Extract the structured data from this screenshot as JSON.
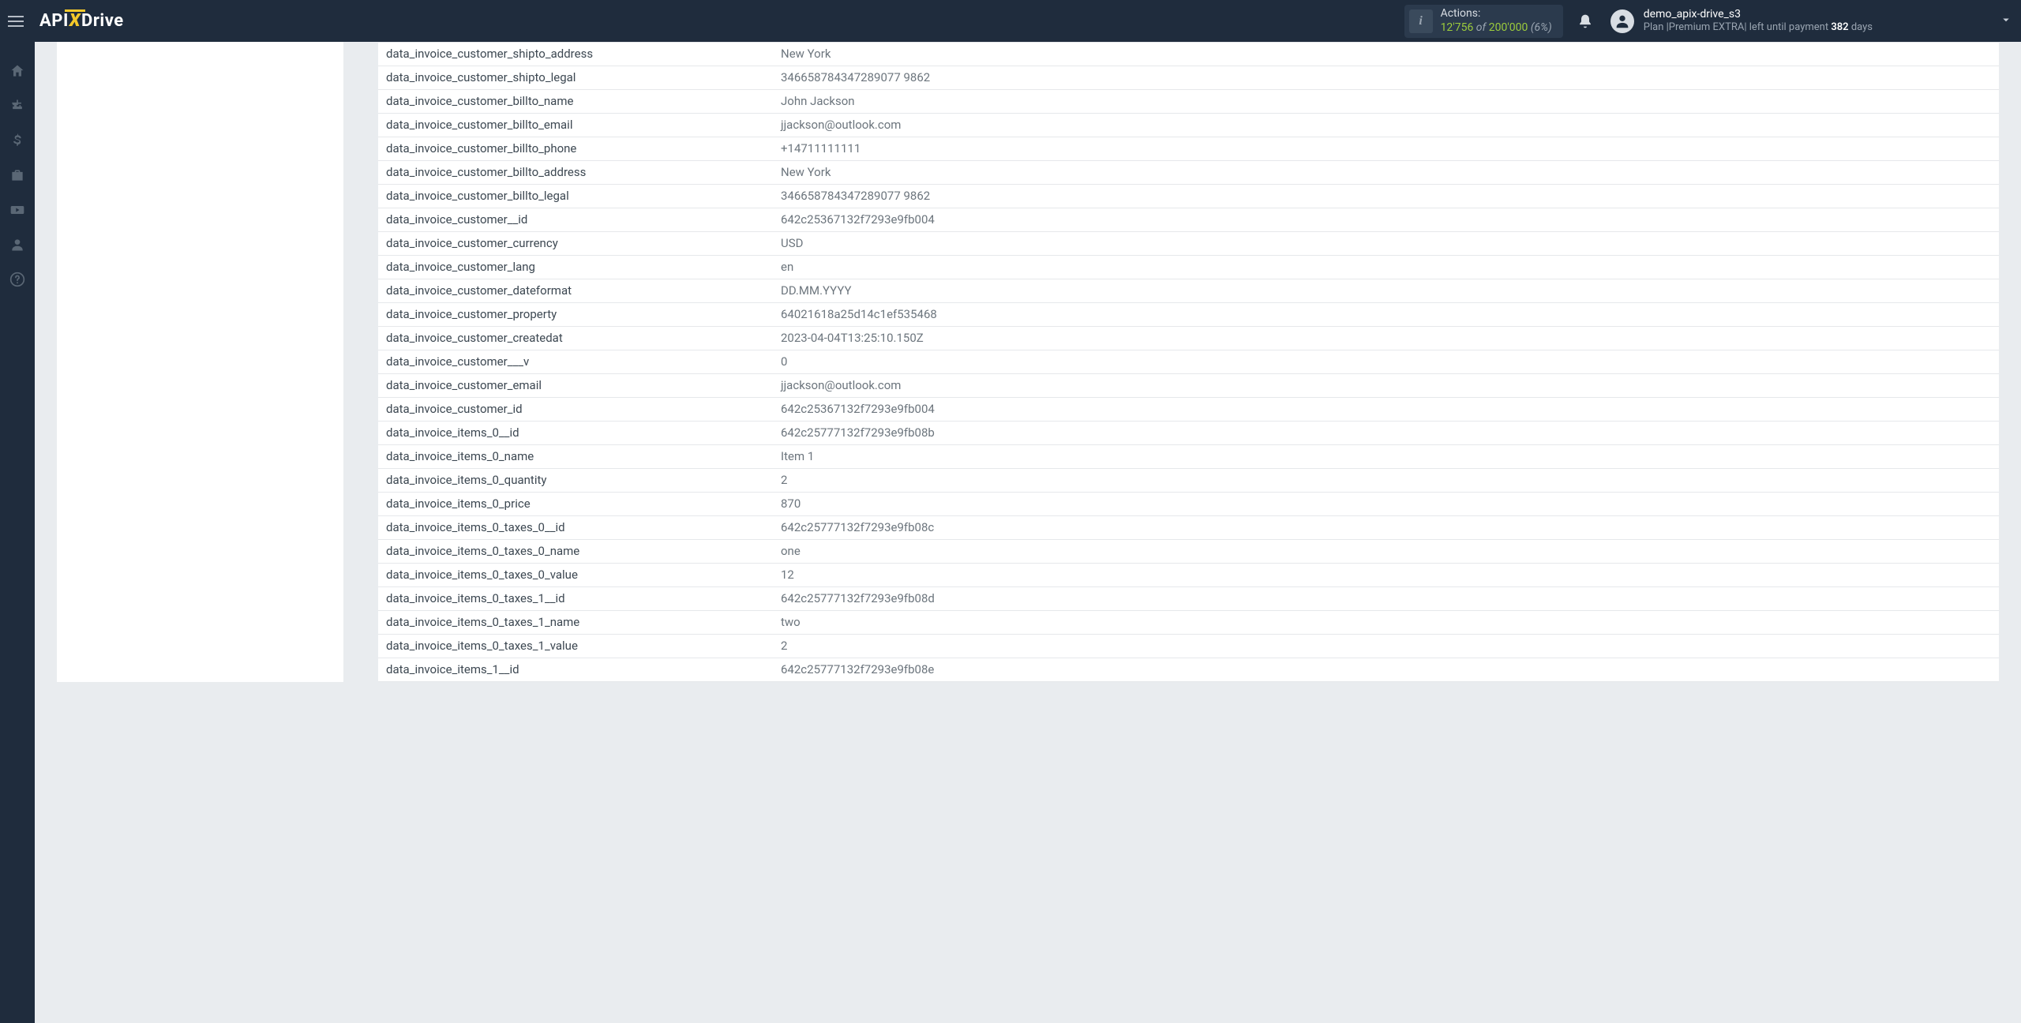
{
  "topbar": {
    "logo_api": "API",
    "logo_x": "X",
    "logo_drive": "Drive",
    "actions": {
      "label": "Actions:",
      "count": "12'756",
      "of": " of ",
      "total": "200'000",
      "pct": " (6%)"
    },
    "user": {
      "username": "demo_apix-drive_s3",
      "plan_prefix": "Plan ",
      "plan_name": "|Premium EXTRA|",
      "plan_suffix": " left until payment ",
      "days_num": "382",
      "days_word": " days"
    }
  },
  "rows": [
    {
      "key": "data_invoice_customer_shipto_address",
      "val": "New York"
    },
    {
      "key": "data_invoice_customer_shipto_legal",
      "val": "346658784347289077 9862"
    },
    {
      "key": "data_invoice_customer_billto_name",
      "val": "John Jackson"
    },
    {
      "key": "data_invoice_customer_billto_email",
      "val": "jjackson@outlook.com"
    },
    {
      "key": "data_invoice_customer_billto_phone",
      "val": "+14711111111"
    },
    {
      "key": "data_invoice_customer_billto_address",
      "val": "New York"
    },
    {
      "key": "data_invoice_customer_billto_legal",
      "val": "346658784347289077 9862"
    },
    {
      "key": "data_invoice_customer__id",
      "val": "642c25367132f7293e9fb004"
    },
    {
      "key": "data_invoice_customer_currency",
      "val": "USD"
    },
    {
      "key": "data_invoice_customer_lang",
      "val": "en"
    },
    {
      "key": "data_invoice_customer_dateformat",
      "val": "DD.MM.YYYY"
    },
    {
      "key": "data_invoice_customer_property",
      "val": "64021618a25d14c1ef535468"
    },
    {
      "key": "data_invoice_customer_createdat",
      "val": "2023-04-04T13:25:10.150Z"
    },
    {
      "key": "data_invoice_customer___v",
      "val": "0"
    },
    {
      "key": "data_invoice_customer_email",
      "val": "jjackson@outlook.com"
    },
    {
      "key": "data_invoice_customer_id",
      "val": "642c25367132f7293e9fb004"
    },
    {
      "key": "data_invoice_items_0__id",
      "val": "642c25777132f7293e9fb08b"
    },
    {
      "key": "data_invoice_items_0_name",
      "val": "Item 1"
    },
    {
      "key": "data_invoice_items_0_quantity",
      "val": "2"
    },
    {
      "key": "data_invoice_items_0_price",
      "val": "870"
    },
    {
      "key": "data_invoice_items_0_taxes_0__id",
      "val": "642c25777132f7293e9fb08c"
    },
    {
      "key": "data_invoice_items_0_taxes_0_name",
      "val": "one"
    },
    {
      "key": "data_invoice_items_0_taxes_0_value",
      "val": "12"
    },
    {
      "key": "data_invoice_items_0_taxes_1__id",
      "val": "642c25777132f7293e9fb08d"
    },
    {
      "key": "data_invoice_items_0_taxes_1_name",
      "val": "two"
    },
    {
      "key": "data_invoice_items_0_taxes_1_value",
      "val": "2"
    },
    {
      "key": "data_invoice_items_1__id",
      "val": "642c25777132f7293e9fb08e"
    }
  ]
}
